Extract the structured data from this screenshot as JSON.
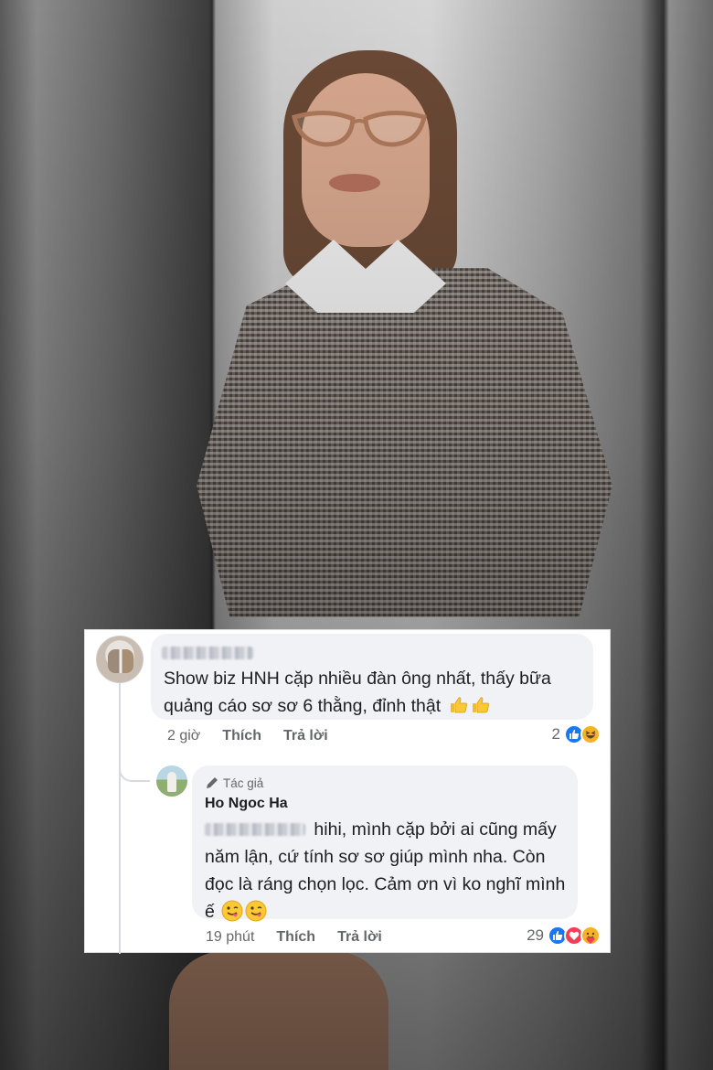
{
  "comments": [
    {
      "text": "Show biz HNH cặp nhiều đàn ông nhất, thấy bữa quảng cáo sơ sơ 6 thằng, đỉnh thật",
      "time": "2 giờ",
      "like_label": "Thích",
      "reply_label": "Trả lời",
      "reaction_count": "2",
      "reactions": [
        "like-icon",
        "haha-icon"
      ],
      "emojis": [
        "thumbs-up-icon",
        "thumbs-up-icon"
      ]
    }
  ],
  "reply": {
    "badge": "Tác giả",
    "author": "Ho Ngoc Ha",
    "text": "hihi, mình cặp bởi ai cũng mấy năm lận, cứ tính sơ sơ giúp mình nha. Còn đọc là ráng chọn lọc. Cảm ơn vì ko nghĩ mình ế",
    "time": "19 phút",
    "like_label": "Thích",
    "reply_label": "Trả lời",
    "reaction_count": "29",
    "reactions": [
      "like-icon",
      "love-icon",
      "care-icon"
    ],
    "emojis": [
      "winking-tongue-face-icon",
      "winking-tongue-face-icon"
    ]
  },
  "colors": {
    "like_blue": "#1877f2",
    "love_red": "#f33e58",
    "haha_yellow": "#f7b125",
    "bubble_bg": "#f0f2f5",
    "meta_gray": "#65676b"
  }
}
